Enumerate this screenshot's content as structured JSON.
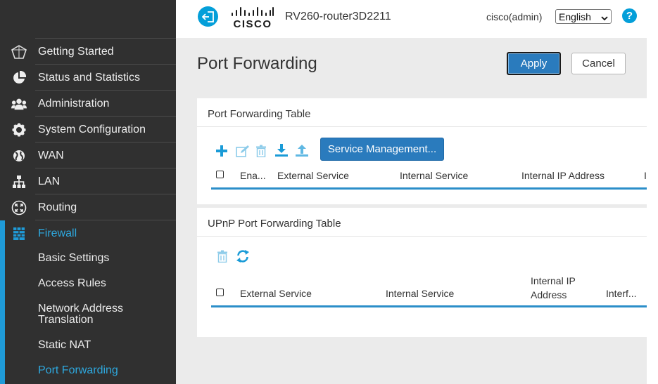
{
  "header": {
    "device_name": "RV260-router3D2211",
    "user": "cisco(admin)",
    "language": "English",
    "help_label": "?",
    "logo_text": "CISCO"
  },
  "sidebar": {
    "items": [
      {
        "label": "Getting Started",
        "icon": "getting-started-icon"
      },
      {
        "label": "Status and Statistics",
        "icon": "pie-chart-icon"
      },
      {
        "label": "Administration",
        "icon": "users-icon"
      },
      {
        "label": "System Configuration",
        "icon": "gear-icon"
      },
      {
        "label": "WAN",
        "icon": "globe-icon"
      },
      {
        "label": "LAN",
        "icon": "network-icon"
      },
      {
        "label": "Routing",
        "icon": "routing-icon"
      },
      {
        "label": "Firewall",
        "icon": "firewall-icon"
      }
    ],
    "firewall_sub": [
      {
        "label": "Basic Settings"
      },
      {
        "label": "Access Rules"
      },
      {
        "label": "Network Address Translation"
      },
      {
        "label": "Static NAT"
      },
      {
        "label": "Port Forwarding"
      }
    ]
  },
  "page": {
    "title": "Port Forwarding",
    "apply_label": "Apply",
    "cancel_label": "Cancel"
  },
  "pf_table": {
    "title": "Port Forwarding Table",
    "service_mgmt_label": "Service Management...",
    "columns": [
      "Ena...",
      "External Service",
      "Internal Service",
      "Internal IP Address",
      "I"
    ]
  },
  "upnp_table": {
    "title": "UPnP Port Forwarding Table",
    "columns": [
      "External Service",
      "Internal Service",
      "Internal IP Address",
      "Interf..."
    ]
  },
  "colors": {
    "sidebar_bg": "#303030",
    "accent_blue": "#2ea8de",
    "button_blue": "#2a7bbd",
    "icon_teal": "#1a9bd7"
  }
}
